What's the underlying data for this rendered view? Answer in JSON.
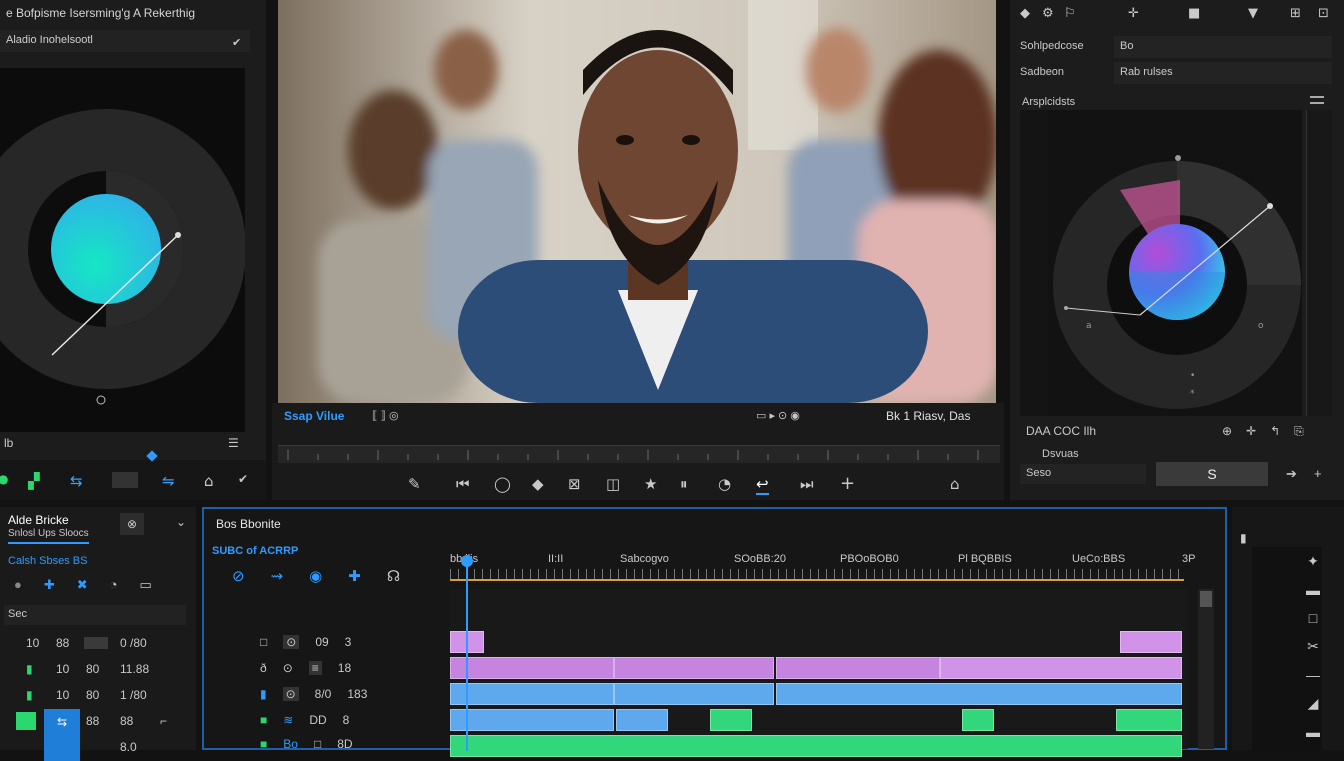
{
  "app": {
    "title": "e Bofpisme Isersming'g A Rekerthig"
  },
  "left_panel": {
    "subtitle": "Aladio Inohelsootl",
    "bottom_label": "lb",
    "bottom_tools": [
      "●",
      "▞",
      "⇆",
      "▭",
      "⇋",
      "⌂",
      "✔"
    ],
    "wheel_colors": {
      "outer": "#2b2b2b",
      "ring": "#111111",
      "inner_a": "#3aa8ff",
      "inner_b": "#15e7c4"
    }
  },
  "viewer": {
    "name_label": "Ssap Vilue",
    "controls_small": [
      "⟦",
      "⟧",
      "◎"
    ],
    "ratio_label": "▭ ▸ ⊙ ◉",
    "time_label": "Bk 1 Riasv, Das",
    "transport": [
      "✎",
      "⏮",
      "◯",
      "◆",
      "⊠",
      "◫",
      "★",
      "⏸",
      "◔",
      "↩",
      "⏭",
      "+",
      "⌂"
    ]
  },
  "right_panel": {
    "top_icons": [
      "◆",
      "⚙",
      "⚐",
      "✛",
      "■",
      "▼",
      "⊞",
      "⊡"
    ],
    "row1_label": "Sohlpedcose",
    "row1_value": "Bo",
    "row2_label": "Sadbeon",
    "row2_value": "Rab rulses",
    "scope_label": "Arsplcidsts",
    "footer_label": "DAA COC Ilh",
    "footer_icons": [
      "⊕",
      "✛",
      "↰",
      "⎘"
    ],
    "bottom_label": "Dsvuas",
    "value_label": "Seso",
    "value_button": "S"
  },
  "project_panel": {
    "tab1": "Alde Bricke",
    "tab2": "Snlosl Ups  Sloocs",
    "section": "Calsh Sbses  BS",
    "tool_icons": [
      "●",
      "✚",
      "✖",
      "◔",
      "▭"
    ],
    "filter": "Sec",
    "rows": [
      [
        "10",
        "88",
        "",
        "0 /80"
      ],
      [
        "",
        "10",
        "80",
        "11.88"
      ],
      [
        "",
        "10",
        "80",
        "1 /80"
      ],
      [
        "",
        "",
        "88",
        "88"
      ],
      [
        "",
        "",
        "",
        "8.0"
      ]
    ]
  },
  "timeline": {
    "title": "Bos Bbonite",
    "seq": "SUBC of ACRRP",
    "timecodes": [
      "bb:ilis",
      "II:II",
      "Sabcogvo",
      "SOoBB:20",
      "PBOoBOB0",
      "Pl BQBBIS",
      "UeCo:BBS",
      "3P"
    ],
    "track_headers": [
      [
        "□",
        "⊙",
        "09",
        "3"
      ],
      [
        "ð",
        "⊙",
        "≡",
        "18"
      ],
      [
        "▮",
        "⊙",
        "8/0",
        "183"
      ],
      [
        "■",
        "≋",
        "DD",
        "8"
      ],
      [
        "■",
        "Bo",
        "□",
        "8D"
      ]
    ]
  },
  "colors": {
    "accent": "#1f5fa6",
    "playhead": "#2f9bff",
    "pink": "#d193e8",
    "blue": "#5ea9ee",
    "green": "#31d77a",
    "ruler": "#d7a13a"
  }
}
